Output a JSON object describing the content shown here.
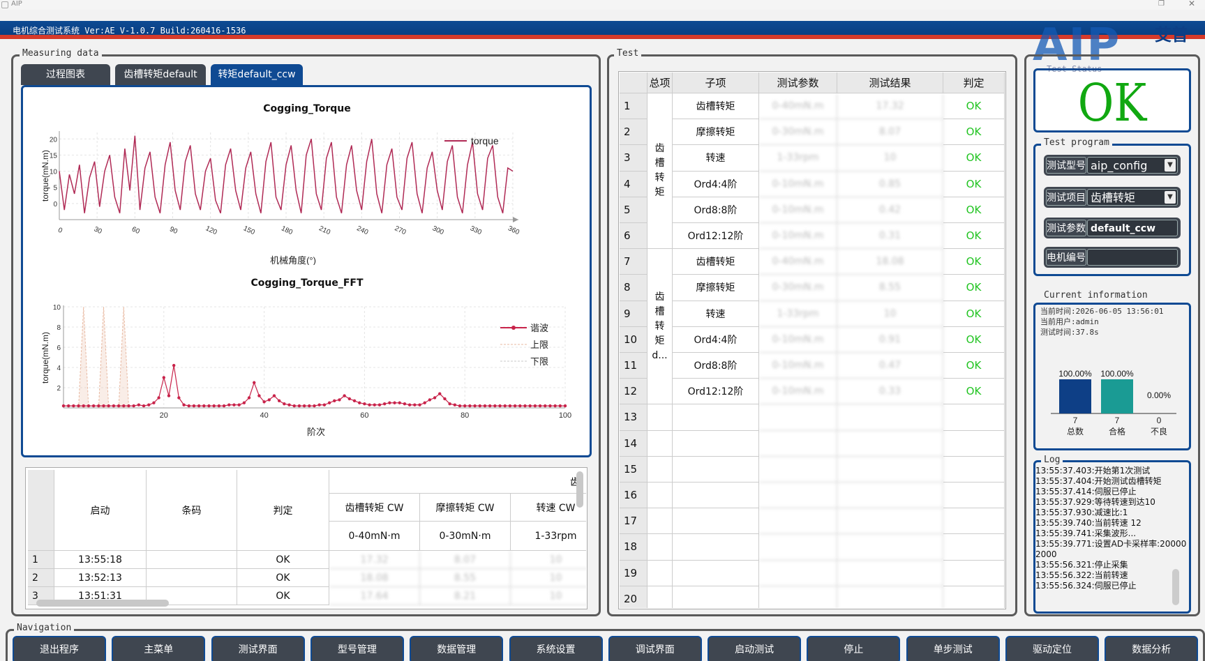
{
  "window": {
    "title": "AIP"
  },
  "header": {
    "title": "电机综合测试系统 Ver:AE V-1.0.7 Build:260416-1536",
    "logo_text": "AIP",
    "logo_cn": "艾普"
  },
  "groups": {
    "measuring": "Measuring data",
    "test": "Test",
    "status": "Test Status",
    "program": "Test program",
    "current": "Current information",
    "log": "Log",
    "navigation": "Navigation"
  },
  "tabs": [
    "过程图表",
    "齿槽转矩default",
    "转矩default_ccw"
  ],
  "chart_data": [
    {
      "type": "line",
      "title": "Cogging_Torque",
      "xlabel": "机械角度(°)",
      "ylabel": "torque(mN.m)",
      "xlim": [
        0,
        360
      ],
      "ylim": [
        -5,
        22
      ],
      "xticks": [
        0,
        30,
        60,
        90,
        120,
        150,
        180,
        210,
        240,
        270,
        300,
        330,
        360
      ],
      "yticks": [
        0,
        5,
        10,
        15,
        20
      ],
      "series": [
        {
          "name": "torque",
          "color": "#b02a55"
        }
      ],
      "x": [
        0,
        4,
        8,
        12,
        16,
        20,
        24,
        28,
        32,
        36,
        40,
        44,
        48,
        52,
        56,
        60,
        64,
        68,
        72,
        76,
        80,
        84,
        88,
        92,
        96,
        100,
        104,
        108,
        112,
        116,
        120,
        124,
        128,
        132,
        136,
        140,
        144,
        148,
        152,
        156,
        160,
        164,
        168,
        172,
        176,
        180,
        184,
        188,
        192,
        196,
        200,
        204,
        208,
        212,
        216,
        220,
        224,
        228,
        232,
        236,
        240,
        244,
        248,
        252,
        256,
        260,
        264,
        268,
        272,
        276,
        280,
        284,
        288,
        292,
        296,
        300,
        304,
        308,
        312,
        316,
        320,
        324,
        328,
        332,
        336,
        340,
        344,
        348,
        352,
        356,
        360
      ],
      "y": [
        10,
        -2,
        9,
        3,
        12,
        -3,
        8,
        13,
        -1,
        10,
        15,
        2,
        -3,
        17,
        4,
        21,
        -2,
        11,
        16,
        2,
        -3,
        12,
        19,
        4,
        -2,
        13,
        18,
        3,
        -2,
        10,
        14,
        1,
        -3,
        12,
        17,
        4,
        -2,
        11,
        16,
        3,
        -3,
        13,
        19,
        2,
        -2,
        12,
        18,
        4,
        -3,
        15,
        20,
        3,
        -2,
        14,
        19,
        2,
        -3,
        12,
        18,
        4,
        -2,
        13,
        20,
        3,
        -3,
        12,
        17,
        2,
        -2,
        14,
        19,
        3,
        -3,
        11,
        16,
        4,
        -2,
        13,
        18,
        2,
        -3,
        12,
        19,
        3,
        -2,
        14,
        18,
        2,
        -3,
        11,
        10
      ]
    },
    {
      "type": "line",
      "title": "Cogging_Torque_FFT",
      "xlabel": "阶次",
      "ylabel": "torque(mN.m)",
      "xlim": [
        0,
        100
      ],
      "ylim": [
        0,
        10
      ],
      "xticks": [
        20,
        40,
        60,
        80,
        100
      ],
      "yticks": [
        2,
        4,
        6,
        8,
        10
      ],
      "series": [
        {
          "name": "谐波",
          "color": "#c8234a",
          "values": [
            0.2,
            0.2,
            0.2,
            0.2,
            0.2,
            0.2,
            0.2,
            0.2,
            0.2,
            0.2,
            0.2,
            0.2,
            0.2,
            0.2,
            0.2,
            0.3,
            0.2,
            0.3,
            0.5,
            1.0,
            3.0,
            1.2,
            4.2,
            1.0,
            0.3,
            0.2,
            0.2,
            0.2,
            0.2,
            0.2,
            0.2,
            0.2,
            0.2,
            0.3,
            0.3,
            0.3,
            0.5,
            1.0,
            2.5,
            1.2,
            0.6,
            0.8,
            1.2,
            0.7,
            0.4,
            0.3,
            0.2,
            0.2,
            0.2,
            0.2,
            0.2,
            0.3,
            0.3,
            0.5,
            0.7,
            0.8,
            1.2,
            0.9,
            0.7,
            0.5,
            0.4,
            0.3,
            0.3,
            0.3,
            0.4,
            0.5,
            0.5,
            0.5,
            0.4,
            0.3,
            0.3,
            0.3,
            0.5,
            0.8,
            1.0,
            1.4,
            0.9,
            0.4,
            0.3,
            0.2,
            0.2,
            0.2,
            0.2,
            0.2,
            0.2,
            0.2,
            0.2,
            0.2,
            0.2,
            0.2,
            0.2,
            0.2,
            0.2,
            0.2,
            0.2,
            0.2,
            0.2,
            0.2,
            0.2,
            0.2,
            0.2
          ]
        },
        {
          "name": "上限",
          "color": "#e8b8a0"
        },
        {
          "name": "下限",
          "color": "#c8c8c8"
        }
      ]
    },
    {
      "type": "bar",
      "categories": [
        "总数",
        "合格",
        "不良"
      ],
      "values": [
        7,
        7,
        0
      ],
      "percent_labels": [
        "100.00%",
        "100.00%",
        "0.00%"
      ],
      "ylim": [
        0,
        7
      ],
      "colors": [
        "#0e3f86",
        "#1a9b94",
        "#cccccc"
      ]
    }
  ],
  "data_table": {
    "group_header": "齿",
    "headers": [
      "启动",
      "条码",
      "判定"
    ],
    "sub_headers": [
      "齿槽转矩 CW",
      "摩擦转矩 CW",
      "转速 CW"
    ],
    "ranges": [
      "0-40mN·m",
      "0-30mN·m",
      "1-33rpm"
    ],
    "rows": [
      {
        "idx": "1",
        "time": "13:55:18",
        "code": "",
        "result": "OK",
        "v1": "17.32",
        "v2": "8.07",
        "v3": "10"
      },
      {
        "idx": "2",
        "time": "13:52:13",
        "code": "",
        "result": "OK",
        "v1": "18.08",
        "v2": "8.55",
        "v3": "10"
      },
      {
        "idx": "3",
        "time": "13:51:31",
        "code": "",
        "result": "OK",
        "v1": "17.64",
        "v2": "8.21",
        "v3": "10"
      }
    ]
  },
  "test_table": {
    "headers": [
      "总项",
      "子项",
      "测试参数",
      "测试结果",
      "判定"
    ],
    "group1": [
      "齿",
      "槽",
      "转",
      "矩"
    ],
    "group2": [
      "齿",
      "槽",
      "转",
      "矩",
      "d..."
    ],
    "rows": [
      {
        "n": "1",
        "sub": "齿槽转矩",
        "param": "0-40mN.m",
        "result": "17.32",
        "judge": "OK"
      },
      {
        "n": "2",
        "sub": "摩擦转矩",
        "param": "0-30mN.m",
        "result": "8.07",
        "judge": "OK"
      },
      {
        "n": "3",
        "sub": "转速",
        "param": "1-33rpm",
        "result": "10",
        "judge": "OK"
      },
      {
        "n": "4",
        "sub": "Ord4:4阶",
        "param": "0-10mN.m",
        "result": "0.85",
        "judge": "OK"
      },
      {
        "n": "5",
        "sub": "Ord8:8阶",
        "param": "0-10mN.m",
        "result": "0.42",
        "judge": "OK"
      },
      {
        "n": "6",
        "sub": "Ord12:12阶",
        "param": "0-10mN.m",
        "result": "0.31",
        "judge": "OK"
      },
      {
        "n": "7",
        "sub": "齿槽转矩",
        "param": "0-40mN.m",
        "result": "18.08",
        "judge": "OK"
      },
      {
        "n": "8",
        "sub": "摩擦转矩",
        "param": "0-30mN.m",
        "result": "8.55",
        "judge": "OK"
      },
      {
        "n": "9",
        "sub": "转速",
        "param": "1-33rpm",
        "result": "10",
        "judge": "OK"
      },
      {
        "n": "10",
        "sub": "Ord4:4阶",
        "param": "0-10mN.m",
        "result": "0.91",
        "judge": "OK"
      },
      {
        "n": "11",
        "sub": "Ord8:8阶",
        "param": "0-10mN.m",
        "result": "0.47",
        "judge": "OK"
      },
      {
        "n": "12",
        "sub": "Ord12:12阶",
        "param": "0-10mN.m",
        "result": "0.33",
        "judge": "OK"
      },
      {
        "n": "13",
        "sub": "",
        "param": "",
        "result": "",
        "judge": ""
      },
      {
        "n": "14",
        "sub": "",
        "param": "",
        "result": "",
        "judge": ""
      },
      {
        "n": "15",
        "sub": "",
        "param": "",
        "result": "",
        "judge": ""
      },
      {
        "n": "16",
        "sub": "",
        "param": "",
        "result": "",
        "judge": ""
      },
      {
        "n": "17",
        "sub": "",
        "param": "",
        "result": "",
        "judge": ""
      },
      {
        "n": "18",
        "sub": "",
        "param": "",
        "result": "",
        "judge": ""
      },
      {
        "n": "19",
        "sub": "",
        "param": "",
        "result": "",
        "judge": ""
      },
      {
        "n": "20",
        "sub": "",
        "param": "",
        "result": "",
        "judge": ""
      }
    ]
  },
  "status": {
    "text": "OK",
    "color": "#11a811"
  },
  "program": {
    "model_label": "测试型号",
    "model_value": "aip_config",
    "item_label": "测试项目",
    "item_value": "齿槽转矩",
    "param_label": "测试参数",
    "param_value": "default_ccw",
    "motor_label": "电机编号",
    "motor_value": ""
  },
  "current_info": {
    "time": "当前时间:2026-06-05 13:56:01",
    "user": "当前用户:admin",
    "duration": "测试时间:37.8s"
  },
  "log": [
    "13:55:37.403:开始第1次测试",
    "13:55:37.404:开始测试齿槽转矩",
    "13:55:37.414:伺服已停止",
    "13:55:37.929:等待转速到达10",
    "13:55:37.930:减速比:1",
    "13:55:39.740:当前转速 12",
    "13:55:39.741:采集波形...",
    "13:55:39.771:设置AD卡采样率:20000 2000",
    "13:55:56.321:停止采集",
    "13:55:56.322:当前转速",
    "13:55:56.324:伺服已停止"
  ],
  "nav": [
    "退出程序",
    "主菜单",
    "测试界面",
    "型号管理",
    "数据管理",
    "系统设置",
    "调试界面",
    "启动测试",
    "停止",
    "单步测试",
    "驱动定位",
    "数据分析"
  ]
}
